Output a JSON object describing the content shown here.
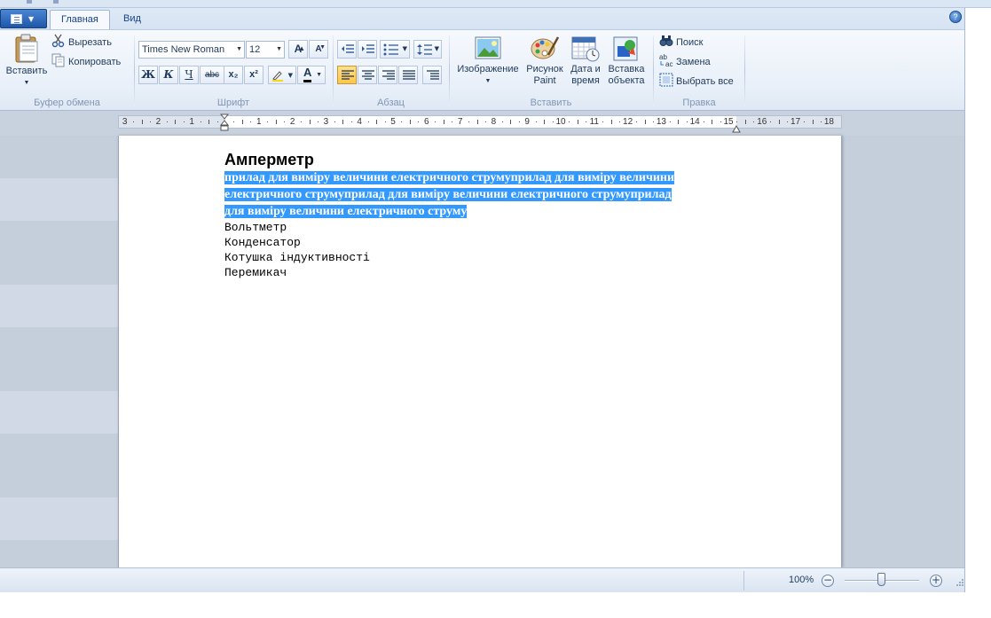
{
  "tabs": [
    {
      "label": "Главная"
    },
    {
      "label": "Вид"
    }
  ],
  "help": {
    "glyph": "?"
  },
  "clipboard": {
    "group_label": "Буфер обмена",
    "paste_label": "Вставить",
    "cut_label": "Вырезать",
    "copy_label": "Копировать"
  },
  "font": {
    "group_label": "Шрифт",
    "family": "Times New Roman",
    "size": "12",
    "bold": "Ж",
    "italic": "К",
    "underline": "Ч",
    "strike": "abc",
    "subscript": "x₂",
    "superscript": "x²",
    "grow": "A",
    "shrink": "A"
  },
  "paragraph": {
    "group_label": "Абзац",
    "alignment": "left"
  },
  "insert": {
    "group_label": "Вставить",
    "picture_label": "Изображение",
    "paint_line1": "Рисунок",
    "paint_line2": "Paint",
    "datetime_line1": "Дата и",
    "datetime_line2": "время",
    "object_line1": "Вставка",
    "object_line2": "объекта"
  },
  "editing": {
    "group_label": "Правка",
    "find_label": "Поиск",
    "replace_label": "Замена",
    "select_all_label": "Выбрать все"
  },
  "ruler": {
    "left_numbers": [
      "3",
      "2",
      "1"
    ],
    "right_numbers": [
      "1",
      "2",
      "3",
      "4",
      "5",
      "6",
      "7",
      "8",
      "9",
      "10",
      "11",
      "12",
      "13",
      "14",
      "15",
      "16",
      "17",
      "18"
    ]
  },
  "document": {
    "heading": "Амперметр",
    "selected_lines": [
      "прилад для виміру величини електричного струмуприлад для виміру величини",
      "електричного струмуприлад для виміру величини електричного струмуприлад",
      "для виміру величини електричного струму "
    ],
    "lines": [
      "Вольтметр",
      "Конденсатор",
      "Котушка індуктивності",
      "Перемикач"
    ]
  },
  "status": {
    "zoom": "100%",
    "zoom_out": "−",
    "zoom_in": "+",
    "zoom_fraction": 0.5
  }
}
